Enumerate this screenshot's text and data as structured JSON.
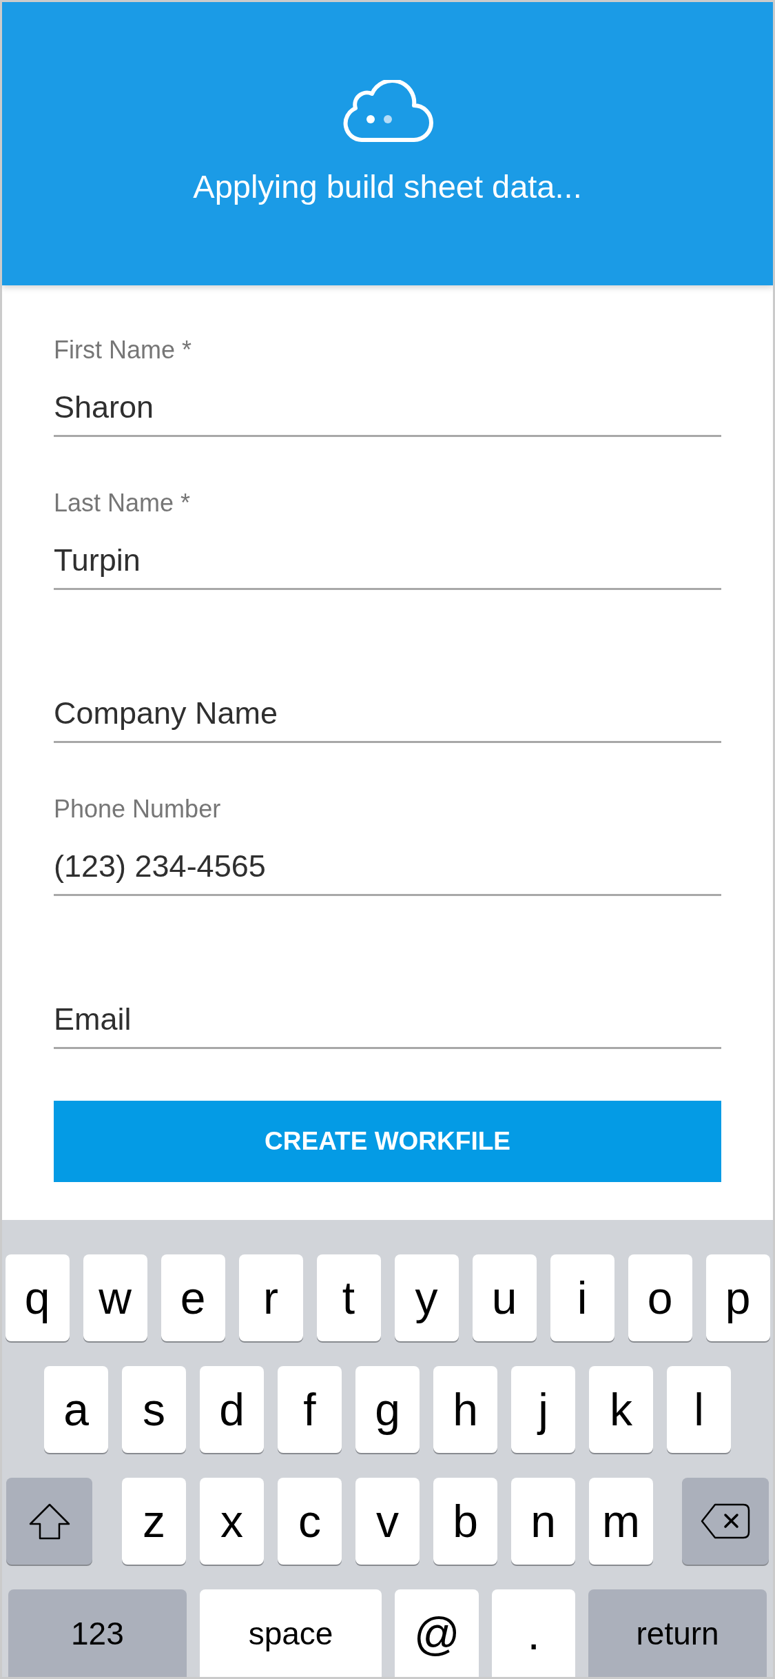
{
  "header": {
    "message": "Applying build sheet data..."
  },
  "form": {
    "fields": [
      {
        "label": "First Name *",
        "value": "Sharon"
      },
      {
        "label": "Last Name *",
        "value": "Turpin"
      },
      {
        "placeholder": "Company Name"
      },
      {
        "label": "Phone Number",
        "value": "(123) 234-4565"
      },
      {
        "placeholder": "Email"
      }
    ],
    "submit_button": "CREATE WORKFILE"
  },
  "keyboard": {
    "key_rows": [
      {
        "keys": [
          {
            "kind": "letter",
            "label": "q"
          },
          {
            "kind": "letter",
            "label": "w"
          },
          {
            "kind": "letter",
            "label": "e"
          },
          {
            "kind": "letter",
            "label": "r"
          },
          {
            "kind": "letter",
            "label": "t"
          },
          {
            "kind": "letter",
            "label": "y"
          },
          {
            "kind": "letter",
            "label": "u"
          },
          {
            "kind": "letter",
            "label": "i"
          },
          {
            "kind": "letter",
            "label": "o"
          },
          {
            "kind": "letter",
            "label": "p"
          }
        ]
      },
      {
        "keys": [
          {
            "kind": "letter",
            "label": "a"
          },
          {
            "kind": "letter",
            "label": "s"
          },
          {
            "kind": "letter",
            "label": "d"
          },
          {
            "kind": "letter",
            "label": "f"
          },
          {
            "kind": "letter",
            "label": "g"
          },
          {
            "kind": "letter",
            "label": "h"
          },
          {
            "kind": "letter",
            "label": "j"
          },
          {
            "kind": "letter",
            "label": "k"
          },
          {
            "kind": "letter",
            "label": "l"
          }
        ]
      },
      {
        "keys": [
          {
            "kind": "shift"
          },
          {
            "kind": "letter",
            "label": "z"
          },
          {
            "kind": "letter",
            "label": "x"
          },
          {
            "kind": "letter",
            "label": "c"
          },
          {
            "kind": "letter",
            "label": "v"
          },
          {
            "kind": "letter",
            "label": "b"
          },
          {
            "kind": "letter",
            "label": "n"
          },
          {
            "kind": "letter",
            "label": "m"
          },
          {
            "kind": "delete"
          }
        ]
      },
      {
        "keys": [
          {
            "kind": "function",
            "label": "123"
          },
          {
            "kind": "space",
            "label": "space"
          },
          {
            "kind": "symbol",
            "label": "@"
          },
          {
            "kind": "symbol",
            "label": "."
          },
          {
            "kind": "function",
            "label": "return"
          }
        ]
      }
    ]
  }
}
